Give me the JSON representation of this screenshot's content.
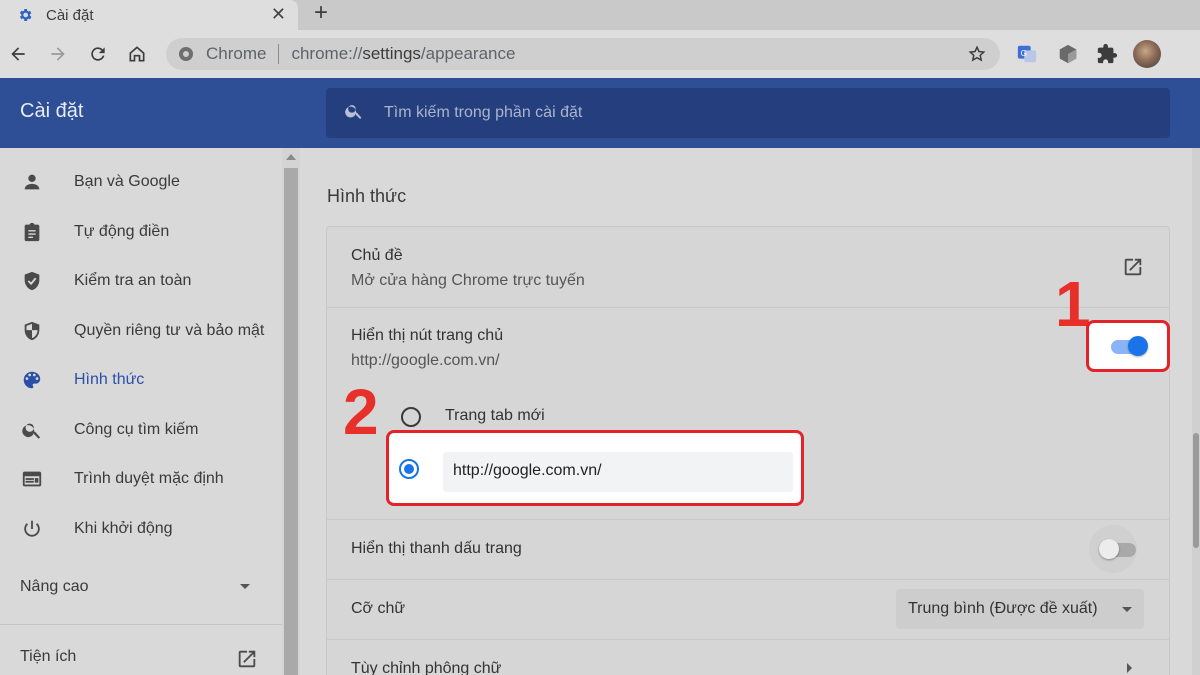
{
  "browser": {
    "tab": {
      "title": "Cài đặt",
      "icon": "gear-icon",
      "close_label": "✕"
    },
    "new_tab_label": "+",
    "omnibox": {
      "site_label": "Chrome",
      "url_prefix": "chrome://",
      "url_path_bold": "settings",
      "url_path_rest": "/appearance"
    }
  },
  "header": {
    "title": "Cài đặt",
    "search_placeholder": "Tìm kiếm trong phần cài đặt"
  },
  "sidebar": {
    "items": [
      {
        "label": "Bạn và Google",
        "icon": "person-icon",
        "active": false
      },
      {
        "label": "Tự động điền",
        "icon": "clipboard-icon",
        "active": false
      },
      {
        "label": "Kiểm tra an toàn",
        "icon": "shield-check-icon",
        "active": false
      },
      {
        "label": "Quyền riêng tư và bảo mật",
        "icon": "shield-icon",
        "active": false
      },
      {
        "label": "Hình thức",
        "icon": "palette-icon",
        "active": true
      },
      {
        "label": "Công cụ tìm kiếm",
        "icon": "search-icon",
        "active": false
      },
      {
        "label": "Trình duyệt mặc định",
        "icon": "browser-icon",
        "active": false
      },
      {
        "label": "Khi khởi động",
        "icon": "power-icon",
        "active": false
      }
    ],
    "advanced_label": "Nâng cao",
    "extensions_label": "Tiện ích"
  },
  "main": {
    "section_title": "Hình thức",
    "theme": {
      "title": "Chủ đề",
      "subtitle": "Mở cửa hàng Chrome trực tuyến"
    },
    "home_button": {
      "title": "Hiển thị nút trang chủ",
      "subtitle": "http://google.com.vn/",
      "enabled": true,
      "options": [
        {
          "label": "Trang tab mới",
          "selected": false
        },
        {
          "label": "",
          "value": "http://google.com.vn/",
          "selected": true
        }
      ]
    },
    "bookmarks_bar": {
      "title": "Hiển thị thanh dấu trang",
      "enabled": false
    },
    "font_size": {
      "title": "Cỡ chữ",
      "selected": "Trung bình (Được đề xuất)"
    },
    "customize_fonts": {
      "title": "Tùy chỉnh phông chữ"
    }
  },
  "annotations": {
    "step1": "1",
    "step2": "2"
  },
  "colors": {
    "header_blue": "#2e4e96",
    "accent_blue": "#1a73e8",
    "annotation_red": "#e3232a"
  }
}
